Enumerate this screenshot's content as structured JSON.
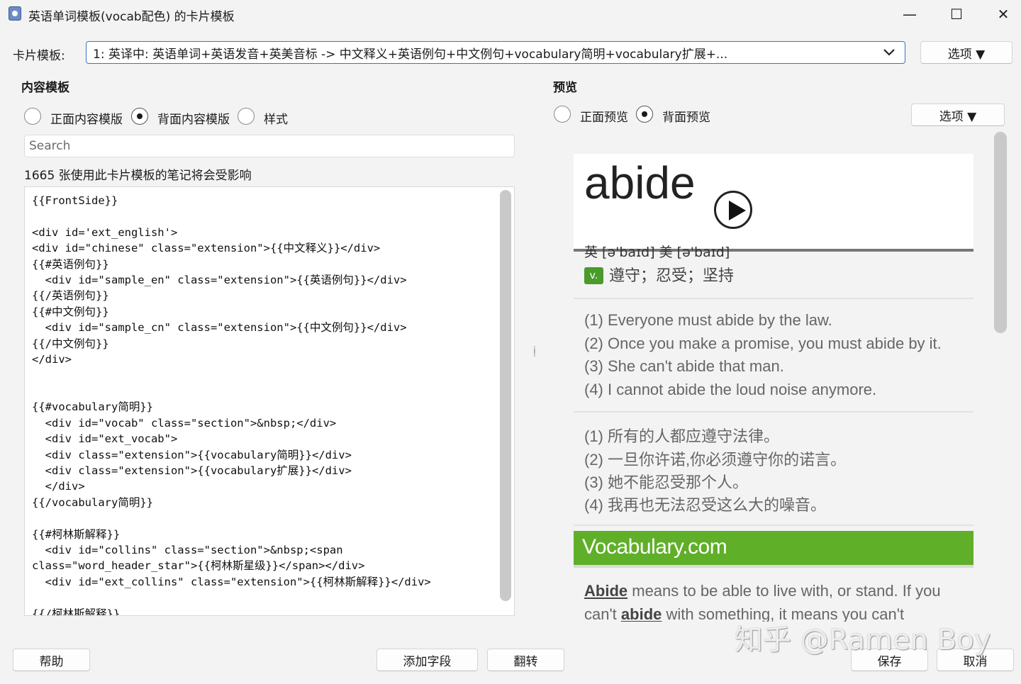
{
  "window": {
    "title": "英语单词模板(vocab配色) 的卡片模板",
    "minimize": "—",
    "maximize": "☐",
    "close": "✕"
  },
  "card_template": {
    "label": "卡片模板:",
    "selected": "1: 英译中: 英语单词+英语发音+英美音标 -> 中文释义+英语例句+中文例句+vocabulary简明+vocabulary扩展+...",
    "options_button": "选项 ▼"
  },
  "content": {
    "heading": "内容模板",
    "radios": [
      "正面内容模版",
      "背面内容模版",
      "样式"
    ],
    "selected_radio": 1,
    "search_placeholder": "Search",
    "notice": "1665 张使用此卡片模板的笔记将会受影响",
    "code": "{{FrontSide}}\n\n<div id='ext_english'>\n<div id=\"chinese\" class=\"extension\">{{中文释义}}</div>\n{{#英语例句}}\n  <div id=\"sample_en\" class=\"extension\">{{英语例句}}</div>\n{{/英语例句}}\n{{#中文例句}}\n  <div id=\"sample_cn\" class=\"extension\">{{中文例句}}</div>\n{{/中文例句}}\n</div>\n\n\n{{#vocabulary简明}}\n  <div id=\"vocab\" class=\"section\">&nbsp;</div>\n  <div id=\"ext_vocab\">\n  <div class=\"extension\">{{vocabulary简明}}</div>\n  <div class=\"extension\">{{vocabulary扩展}}</div>\n  </div>\n{{/vocabulary简明}}\n\n{{#柯林斯解释}}\n  <div id=\"collins\" class=\"section\">&nbsp;<span\nclass=\"word_header_star\">{{柯林斯星级}}</span></div>\n  <div id=\"ext_collins\" class=\"extension\">{{柯林斯解释}}</div>\n\n{{/柯林斯解释}}"
  },
  "preview": {
    "heading": "预览",
    "radios": [
      "正面预览",
      "背面预览"
    ],
    "selected_radio": 1,
    "options_button": "选项 ▼",
    "word": "abide",
    "phonetic": "英 [ə'baɪd] 美 [ə'baɪd]",
    "pos": "v.",
    "meaning": "遵守；忍受；坚持",
    "examples_en": [
      "(1) Everyone must abide by the law.",
      "(2) Once you make a promise, you must abide by it.",
      "(3) She can't abide that man.",
      "(4) I cannot abide the loud noise anymore."
    ],
    "examples_cn": [
      "(1) 所有的人都应遵守法律。",
      "(2) 一旦你许诺,你必须遵守你的诺言。",
      "(3) 她不能忍受那个人。",
      "(4) 我再也无法忍受这么大的噪音。"
    ],
    "vocab_logo": "Vocabulary.com",
    "vocab_word1": "Abide",
    "vocab_mid1": " means to be able to live with, or stand. If you can't ",
    "vocab_word2": "abide",
    "vocab_mid2": " with something, it means you can't"
  },
  "buttons": {
    "help": "帮助",
    "add_field": "添加字段",
    "flip": "翻转",
    "save": "保存",
    "cancel": "取消"
  },
  "watermark": "知乎 @Ramen Boy"
}
